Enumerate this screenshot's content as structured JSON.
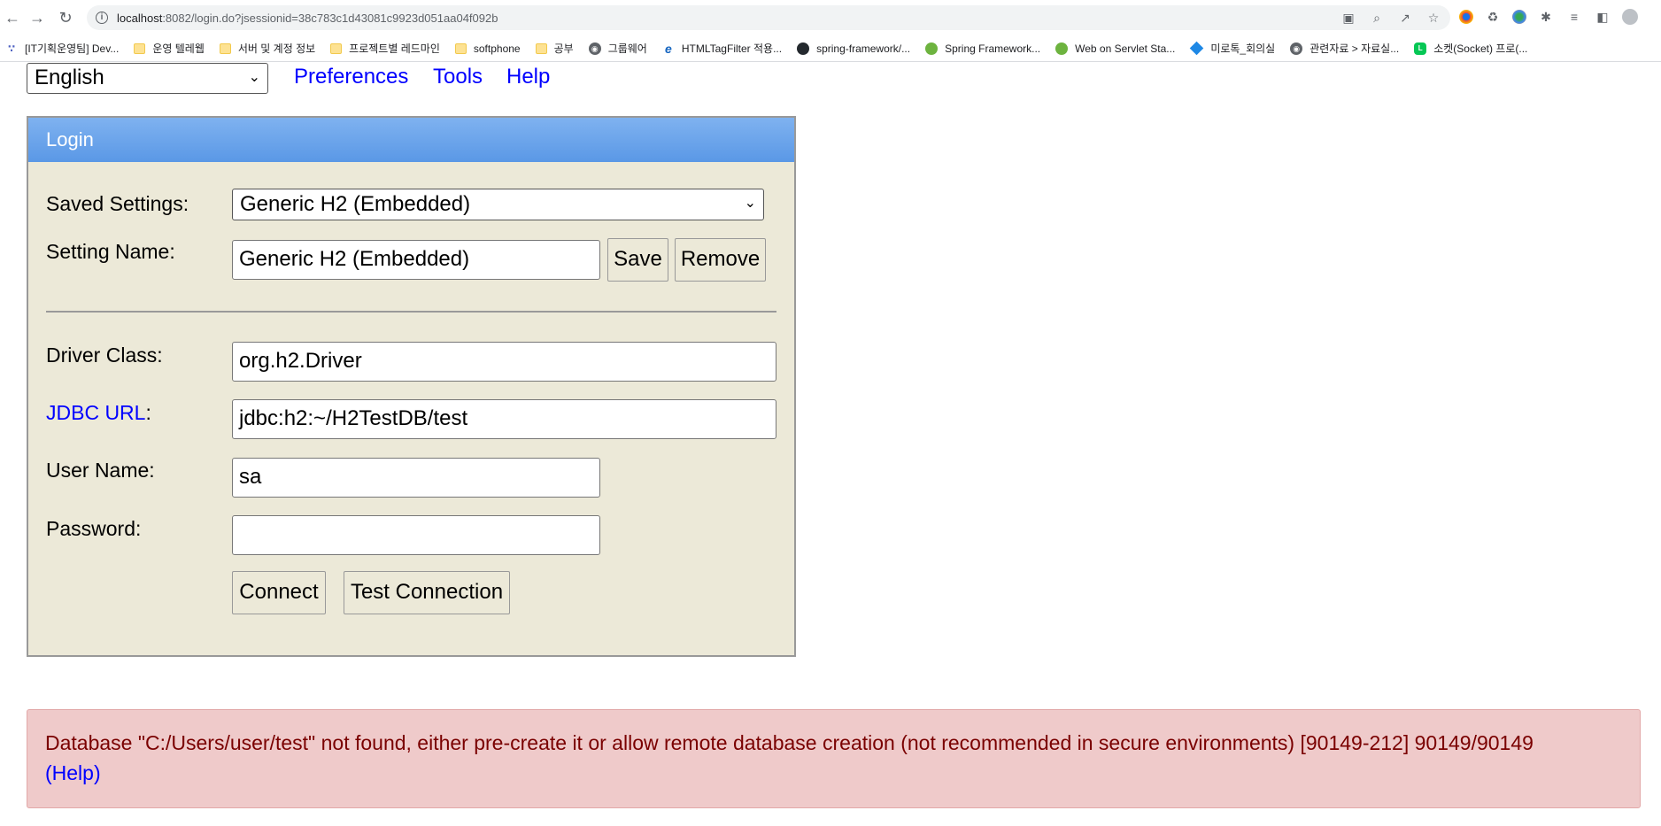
{
  "browser": {
    "url_host": "localhost",
    "url_rest": ":8082/login.do?jsessionid=38c783c1d43081c9923d051aa04f092b",
    "bookmarks": [
      {
        "icon": "wave-icon",
        "label": "[IT기획운영팀] Dev..."
      },
      {
        "icon": "folder-icon",
        "label": "운영 텔레웹"
      },
      {
        "icon": "folder-icon",
        "label": "서버 및 계정 정보"
      },
      {
        "icon": "folder-icon",
        "label": "프로젝트별 레드마인"
      },
      {
        "icon": "folder-icon",
        "label": "softphone"
      },
      {
        "icon": "folder-icon",
        "label": "공부"
      },
      {
        "icon": "globe-icon",
        "label": "그룹웨어"
      },
      {
        "icon": "ie-icon",
        "label": "HTMLTagFilter 적용..."
      },
      {
        "icon": "github-icon",
        "label": "spring-framework/..."
      },
      {
        "icon": "spring-icon",
        "label": "Spring Framework..."
      },
      {
        "icon": "spring-icon",
        "label": "Web on Servlet Sta..."
      },
      {
        "icon": "cube-icon",
        "label": "미로톡_회의실"
      },
      {
        "icon": "globe-icon",
        "label": "관련자료 > 자료실..."
      },
      {
        "icon": "line-icon",
        "label": "소켓(Socket) 프로(..."
      }
    ]
  },
  "top": {
    "language": "English",
    "links": [
      "Preferences",
      "Tools",
      "Help"
    ]
  },
  "login": {
    "header": "Login",
    "saved_settings_label": "Saved Settings:",
    "saved_settings_value": "Generic H2 (Embedded)",
    "setting_name_label": "Setting Name:",
    "setting_name_value": "Generic H2 (Embedded)",
    "save_label": "Save",
    "remove_label": "Remove",
    "driver_class_label": "Driver Class:",
    "driver_class_value": "org.h2.Driver",
    "jdbc_url_link": "JDBC URL",
    "jdbc_url_colon": ":",
    "jdbc_url_value": "jdbc:h2:~/H2TestDB/test",
    "user_name_label": "User Name:",
    "user_name_value": "sa",
    "password_label": "Password:",
    "password_value": "",
    "connect_label": "Connect",
    "test_connection_label": "Test Connection"
  },
  "error": {
    "message": "Database \"C:/Users/user/test\" not found, either pre-create it or allow remote database creation (not recommended in secure environments) [90149-212] 90149/90149",
    "help_link": "(Help)"
  }
}
